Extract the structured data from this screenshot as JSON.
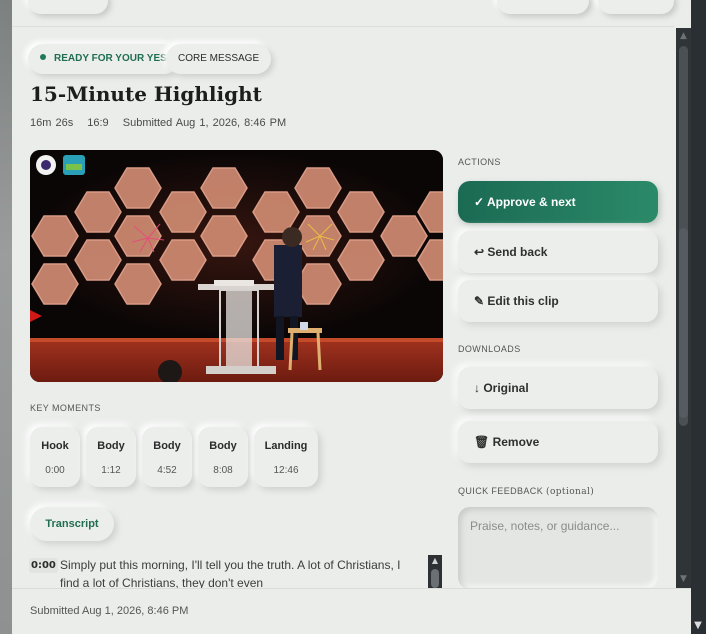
{
  "status_pill": {
    "label": "READY FOR YOUR YES",
    "color": "#1e7a58"
  },
  "category_pill": {
    "label": "CORE MESSAGE"
  },
  "clip": {
    "title": "15-Minute Highlight",
    "duration": "16m 26s",
    "aspect": "16:9",
    "submitted": "Submitted Aug 1, 2026, 8:46 PM"
  },
  "key_moments": {
    "label": "KEY MOMENTS",
    "items": [
      {
        "label": "Hook",
        "time": "0:00"
      },
      {
        "label": "Body",
        "time": "1:12"
      },
      {
        "label": "Body",
        "time": "4:52"
      },
      {
        "label": "Body",
        "time": "8:08"
      },
      {
        "label": "Landing",
        "time": "12:46"
      }
    ]
  },
  "transcript": {
    "tab_label": "Transcript",
    "time": "0:00",
    "text": "Simply put this morning, I'll tell you the truth. A lot of Christians, I find a lot of Christians, they don't even"
  },
  "actions": {
    "label": "ACTIONS",
    "approve": "✓ Approve & next",
    "send_back": "↩ Send back",
    "edit": "✎ Edit this clip"
  },
  "downloads": {
    "label": "DOWNLOADS",
    "original": "↓ Original",
    "remove": "🗑 Remove"
  },
  "feedback": {
    "label": "QUICK FEEDBACK",
    "optional": "(optional)",
    "placeholder": "Praise, notes, or guidance..."
  },
  "footer": {
    "text": "Submitted Aug 1, 2026, 8:46 PM"
  },
  "colors": {
    "accent": "#1f6e52",
    "accent_button": "#1b6a53"
  }
}
